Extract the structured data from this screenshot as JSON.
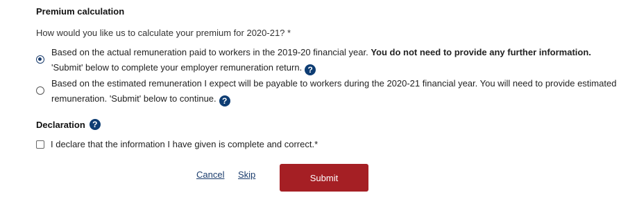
{
  "premium": {
    "title": "Premium calculation",
    "question": "How would you like us to calculate your premium for 2020-21? *",
    "options": [
      {
        "text_a": "Based on the actual remuneration paid to workers in the 2019-20 financial year. ",
        "text_bold": "You do not need to provide any further information.",
        "text_b": " 'Submit' below to complete your employer remuneration return.",
        "selected": true
      },
      {
        "text_a": "Based on the estimated remuneration I expect will be payable to workers during the 2020-21 financial year. You will need to provide estimated remuneration. 'Submit' below to continue.",
        "selected": false
      }
    ]
  },
  "declaration": {
    "title": "Declaration",
    "checkbox_label": "I declare that the information I have given is complete and correct.*",
    "checked": false
  },
  "actions": {
    "cancel_label": "Cancel",
    "skip_label": "Skip",
    "submit_label": "Submit"
  },
  "icons": {
    "help": "question-mark-icon",
    "help_glyph": "?"
  },
  "colors": {
    "accent": "#1b3d6d",
    "help_icon": "#0e3d73",
    "submit_bg": "#a51f24"
  }
}
